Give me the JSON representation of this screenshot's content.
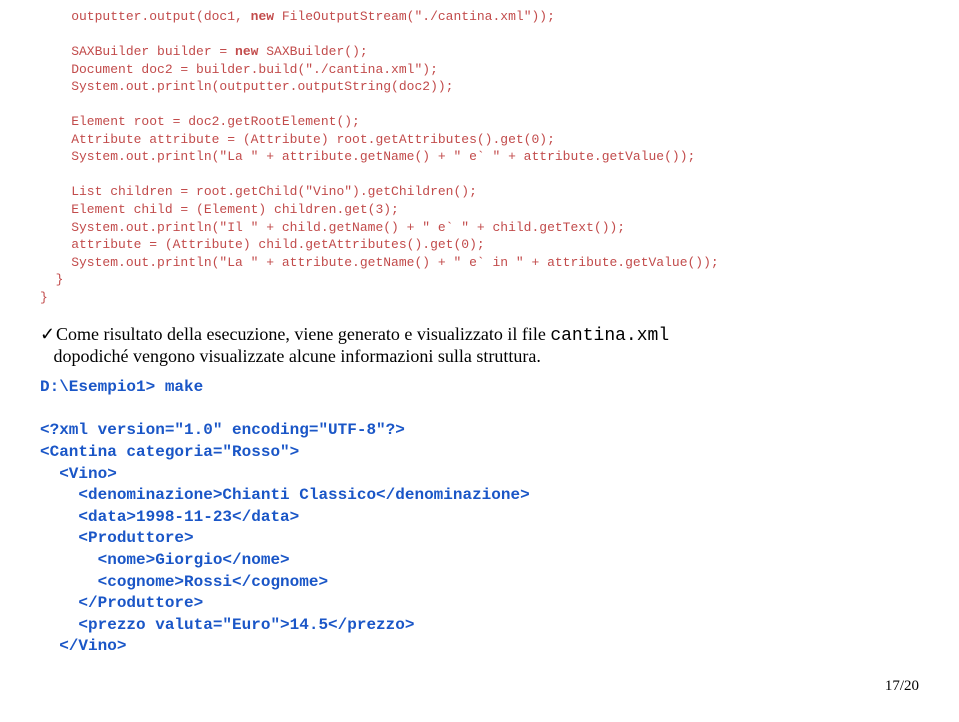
{
  "java": {
    "l1": "    outputter.output(doc1, ",
    "kw1": "new",
    "l1b": " FileOutputStream(\"./cantina.xml\"));",
    "blank": "",
    "l2": "    SAXBuilder builder = ",
    "kw2": "new",
    "l2b": " SAXBuilder();",
    "l3": "    Document doc2 = builder.build(\"./cantina.xml\");",
    "l4": "    System.out.println(outputter.outputString(doc2));",
    "l5": "    Element root = doc2.getRootElement();",
    "l6": "    Attribute attribute = (Attribute) root.getAttributes().get(0);",
    "l7": "    System.out.println(\"La \" + attribute.getName() + \" e` \" + attribute.getValue());",
    "l8": "    List children = root.getChild(\"Vino\").getChildren();",
    "l9": "    Element child = (Element) children.get(3);",
    "l10": "    System.out.println(\"Il \" + child.getName() + \" e` \" + child.getText());",
    "l11": "    attribute = (Attribute) child.getAttributes().get(0);",
    "l12": "    System.out.println(\"La \" + attribute.getName() + \" e` in \" + attribute.getValue());",
    "l13": "  }",
    "l14": "}"
  },
  "para": {
    "check": "✓",
    "text1": "Come risultato della esecuzione, viene generato e visualizzato il file ",
    "file": "cantina.xml",
    "text2": "dopodiché vengono visualizzate alcune informazioni sulla struttura."
  },
  "term": {
    "l1": "D:\\Esempio1> make",
    "l2": "<?xml version=\"1.0\" encoding=\"UTF-8\"?>",
    "l3": "<Cantina categoria=\"Rosso\">",
    "l4": "  <Vino>",
    "l5": "    <denominazione>Chianti Classico</denominazione>",
    "l6": "    <data>1998-11-23</data>",
    "l7": "    <Produttore>",
    "l8": "      <nome>Giorgio</nome>",
    "l9": "      <cognome>Rossi</cognome>",
    "l10": "    </Produttore>",
    "l11": "    <prezzo valuta=\"Euro\">14.5</prezzo>",
    "l12": "  </Vino>"
  },
  "page": "17/20"
}
